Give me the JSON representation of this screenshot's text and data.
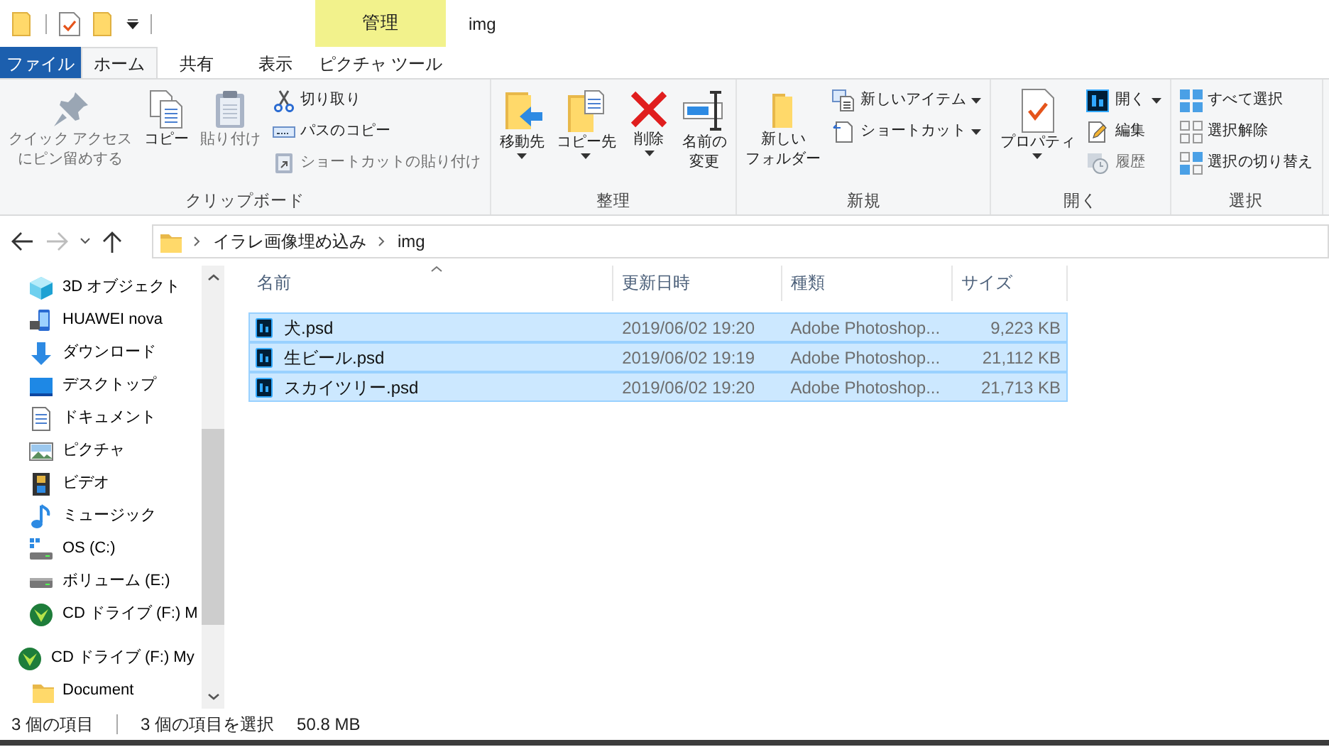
{
  "title_bar": {
    "context_label": "管理",
    "title": "img"
  },
  "ribbon_tabs": [
    {
      "label": "ファイル",
      "kind": "file",
      "selected": false
    },
    {
      "label": "ホーム",
      "kind": "tab",
      "selected": true
    },
    {
      "label": "共有",
      "kind": "tab",
      "selected": false
    },
    {
      "label": "表示",
      "kind": "tab",
      "selected": false
    },
    {
      "label": "ピクチャ ツール",
      "kind": "context",
      "selected": false
    }
  ],
  "ribbon_groups": [
    {
      "label": "クリップボード",
      "buttons": [
        {
          "label_lines": [
            "クイック アクセス",
            "にピン留めする"
          ],
          "kind": "large",
          "dropdown": false,
          "disabled": true
        },
        {
          "label": "コピー",
          "kind": "large",
          "dropdown": false,
          "disabled": false
        },
        {
          "label": "貼り付け",
          "kind": "large",
          "dropdown": false,
          "disabled": true
        },
        {
          "label": "切り取り",
          "kind": "small",
          "dropdown": false,
          "disabled": false
        },
        {
          "label": "パスのコピー",
          "kind": "small",
          "dropdown": false,
          "disabled": false
        },
        {
          "label": "ショートカットの貼り付け",
          "kind": "small",
          "dropdown": false,
          "disabled": true
        }
      ]
    },
    {
      "label": "整理",
      "buttons": [
        {
          "label": "移動先",
          "kind": "large",
          "dropdown": true,
          "disabled": false
        },
        {
          "label": "コピー先",
          "kind": "large",
          "dropdown": true,
          "disabled": false
        },
        {
          "label": "削除",
          "kind": "large",
          "dropdown": true,
          "disabled": false
        },
        {
          "label_lines": [
            "名前の",
            "変更"
          ],
          "kind": "large",
          "dropdown": false,
          "disabled": false
        }
      ]
    },
    {
      "label": "新規",
      "buttons": [
        {
          "label_lines": [
            "新しい",
            "フォルダー"
          ],
          "kind": "large",
          "dropdown": false,
          "disabled": false
        },
        {
          "label": "新しいアイテム",
          "kind": "small",
          "dropdown": true,
          "disabled": false
        },
        {
          "label": "ショートカット",
          "kind": "small",
          "dropdown": true,
          "disabled": false
        }
      ]
    },
    {
      "label": "開く",
      "buttons": [
        {
          "label": "プロパティ",
          "kind": "large",
          "dropdown": true,
          "disabled": false
        },
        {
          "label": "開く",
          "kind": "small",
          "dropdown": true,
          "disabled": false
        },
        {
          "label": "編集",
          "kind": "small",
          "dropdown": false,
          "disabled": false
        },
        {
          "label": "履歴",
          "kind": "small",
          "dropdown": false,
          "disabled": true
        }
      ]
    },
    {
      "label": "選択",
      "buttons": [
        {
          "label": "すべて選択",
          "kind": "small",
          "dropdown": false,
          "disabled": false
        },
        {
          "label": "選択解除",
          "kind": "small",
          "dropdown": false,
          "disabled": false
        },
        {
          "label": "選択の切り替え",
          "kind": "small",
          "dropdown": false,
          "disabled": false
        }
      ]
    }
  ],
  "address_bar": {
    "forward_disabled": true,
    "path": [
      "イラレ画像埋め込み",
      "img"
    ]
  },
  "nav_pane": {
    "pc_children": [
      {
        "label": "3D オブジェクト"
      },
      {
        "label": "HUAWEI nova"
      },
      {
        "label": "ダウンロード"
      },
      {
        "label": "デスクトップ"
      },
      {
        "label": "ドキュメント"
      },
      {
        "label": "ピクチャ"
      },
      {
        "label": "ビデオ"
      },
      {
        "label": "ミュージック"
      },
      {
        "label": "OS (C:)"
      },
      {
        "label": "ボリューム (E:)"
      },
      {
        "label": "CD ドライブ (F:) M"
      }
    ],
    "tree": [
      {
        "label": "CD ドライブ (F:) My",
        "children": [
          {
            "label": "Document"
          }
        ]
      }
    ]
  },
  "file_list": {
    "columns": [
      {
        "label": "名前",
        "sorted": true
      },
      {
        "label": "更新日時",
        "sorted": false
      },
      {
        "label": "種類",
        "sorted": false
      },
      {
        "label": "サイズ",
        "sorted": false
      }
    ],
    "rows": [
      {
        "name": "犬.psd",
        "modified": "2019/06/02 19:20",
        "type": "Adobe Photoshop...",
        "size": "9,223 KB",
        "selected": true
      },
      {
        "name": "生ビール.psd",
        "modified": "2019/06/02 19:19",
        "type": "Adobe Photoshop...",
        "size": "21,112 KB",
        "selected": true
      },
      {
        "name": "スカイツリー.psd",
        "modified": "2019/06/02 19:20",
        "type": "Adobe Photoshop...",
        "size": "21,713 KB",
        "selected": true
      }
    ]
  },
  "status_bar": {
    "item_count": "3 個の項目",
    "selection": "3 個の項目を選択",
    "selection_size": "50.8 MB"
  }
}
